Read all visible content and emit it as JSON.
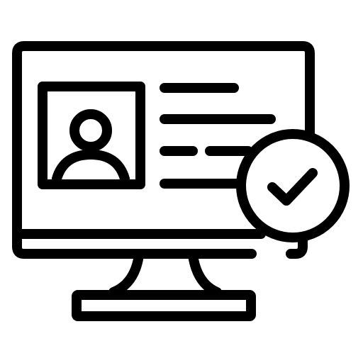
{
  "colors": {
    "background": "#ffffff",
    "stroke": "#000000"
  },
  "icon": {
    "name": "verified-profile-monitor-icon",
    "parts": [
      "monitor-icon",
      "profile-photo-icon",
      "text-lines",
      "check-badge-icon"
    ]
  }
}
